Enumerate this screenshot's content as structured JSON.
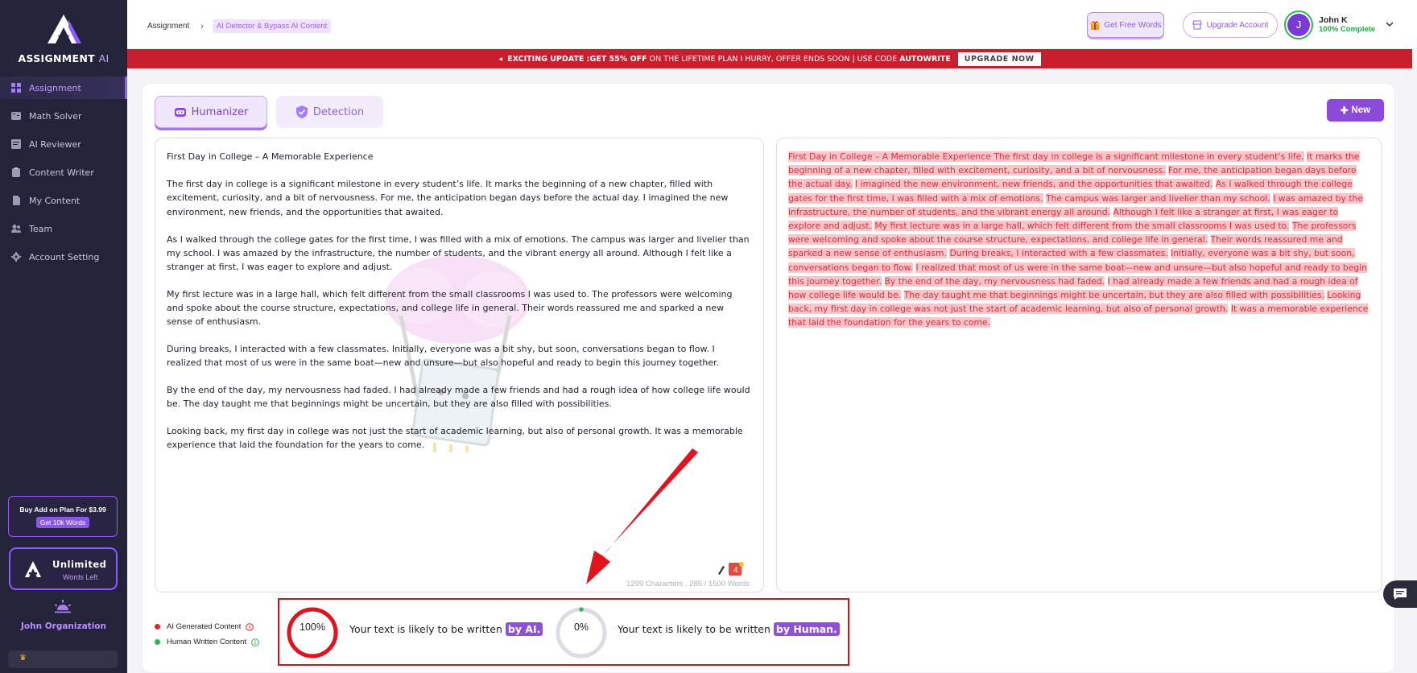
{
  "brand": {
    "name": "ASSIGNMENT",
    "suffix": "AI"
  },
  "sidebar": {
    "items": [
      {
        "label": "Assignment",
        "icon": "grid-icon",
        "active": true
      },
      {
        "label": "Math Solver",
        "icon": "math-icon"
      },
      {
        "label": "AI Reviewer",
        "icon": "reviewer-icon"
      },
      {
        "label": "Content Writer",
        "icon": "clipboard-icon"
      },
      {
        "label": "My Content",
        "icon": "file-icon"
      },
      {
        "label": "Team",
        "icon": "team-icon"
      },
      {
        "label": "Account Setting",
        "icon": "gear-icon"
      }
    ],
    "addon": {
      "title": "Buy Add on Plan For $3.99",
      "button": "Get 10k Words"
    },
    "words": {
      "title": "Unlimited",
      "subtitle": "Words Left"
    },
    "organization": "John Organization"
  },
  "topbar": {
    "breadcrumb": {
      "root": "Assignment",
      "current": "AI Detector & Bypass AI Content"
    },
    "free_words": "Get Free Words",
    "upgrade": "Upgrade Account",
    "user": {
      "initial": "J",
      "name": "John K",
      "status": "100% Complete"
    }
  },
  "promo": {
    "prefix": "EXCITING UPDATE : ",
    "highlight": "GET 55% OFF",
    "middle": " ON THE LIFETIME PLAN I HURRY, OFFER ENDS SOON | USE CODE ",
    "code": "AUTOWRITE",
    "cta": "UPGRADE NOW"
  },
  "tabs": {
    "humanizer": "Humanizer",
    "detection": "Detection",
    "new": "New"
  },
  "input": {
    "title": "First Day in College – A Memorable Experience",
    "paragraphs": [
      "The first day in college is a significant milestone in every student’s life. It marks the beginning of a new chapter, filled with excitement, curiosity, and a bit of nervousness. For me, the anticipation began days before the actual day. I imagined the new environment, new friends, and the opportunities that awaited.",
      "As I walked through the college gates for the first time, I was filled with a mix of emotions. The campus was larger and livelier than my school. I was amazed by the infrastructure, the number of students, and the vibrant energy all around. Although I felt like a stranger at first, I was eager to explore and adjust.",
      "My first lecture was in a large hall, which felt different from the small classrooms I was used to. The professors were welcoming and spoke about the course structure, expectations, and college life in general. Their words reassured me and sparked a new sense of enthusiasm.",
      "During breaks, I interacted with a few classmates. Initially, everyone was a bit shy, but soon, conversations began to flow. I realized that most of us were in the same boat—new and unsure—but also hopeful and ready to begin this journey together.",
      "By the end of the day, my nervousness had faded. I had already made a few friends and had a rough idea of how college life would be. The day taught me that beginnings might be uncertain, but they are also filled with possibilities.",
      "Looking back, my first day in college was not just the start of academic learning, but also of personal growth. It was a memorable experience that laid the foundation for the years to come."
    ],
    "counter": "1299 Characters , 285 / 1500 Words"
  },
  "output": {
    "sentences": [
      "First Day in College – A Memorable Experience The first day in college is a significant milestone in every student’s life.",
      "It marks the beginning of a new chapter, filled with excitement, curiosity, and a bit of nervousness.",
      "For me, the anticipation began days before the actual day.",
      "I imagined the new environment, new friends, and the opportunities that awaited.",
      "As I walked through the college gates for the first time, I was filled with a mix of emotions.",
      "The campus was larger and livelier than my school.",
      "I was amazed by the infrastructure, the number of students, and the vibrant energy all around.",
      "Although I felt like a stranger at first, I was eager to explore and adjust.",
      "My first lecture was in a large hall, which felt different from the small classrooms I was used to.",
      "The professors were welcoming and spoke about the course structure, expectations, and college life in general.",
      "Their words reassured me and sparked a new sense of enthusiasm.",
      "During breaks, I interacted with a few classmates.",
      "Initially, everyone was a bit shy, but soon, conversations began to flow.",
      "I realized that most of us were in the same boat—new and unsure—but also hopeful and ready to begin this journey together.",
      "By the end of the day, my nervousness had faded.",
      "I had already made a few friends and had a rough idea of how college life would be.",
      "The day taught me that beginnings might be uncertain, but they are also filled with possibilities.",
      "Looking back, my first day in college was not just the start of academic learning, but also of personal growth.",
      "It was a memorable experience that laid the foundation for the years to come."
    ]
  },
  "legend": {
    "ai": "AI Generated Content",
    "human": "Human Written Content"
  },
  "results": {
    "ai": {
      "value": 1.0,
      "label": "100%",
      "text": "Your text is likely to be written ",
      "pill": "by AI."
    },
    "human": {
      "value": 0.0,
      "label": "0%",
      "text": "Your text is likely to be written ",
      "pill": "by Human."
    }
  },
  "colors": {
    "accent": "#8c4ad9",
    "ai": "#e0262f",
    "human": "#2fb650",
    "promo": "#c81e2d"
  }
}
